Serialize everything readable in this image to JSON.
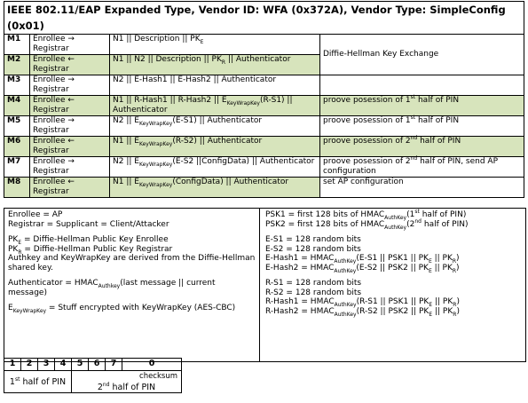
{
  "header": "IEEE 802.11/EAP Expanded Type, Vendor ID: WFA (0x372A), Vendor Type: SimpleConfig (0x01)",
  "messages": [
    {
      "id": "M1",
      "dir": "Enrollee → Registrar",
      "content": "N1 || Description || PK",
      "content_sub": "E",
      "content_rest": "",
      "purpose": ""
    },
    {
      "id": "M2",
      "dir": "Enrollee ← Registrar",
      "content": "N1 || N2 || Description || PK",
      "content_sub": "R",
      "content_rest": " || Authenticator",
      "purpose": ""
    },
    {
      "id": "M3",
      "dir": "Enrollee → Registrar",
      "content": "N2 || E-Hash1 || E-Hash2 || Authenticator",
      "content_sub": "",
      "content_rest": "",
      "purpose": ""
    },
    {
      "id": "M4",
      "dir": "Enrollee ← Registrar",
      "content": "N1 || R-Hash1 || R-Hash2 || E",
      "content_sub": "KeyWrapKey",
      "content_rest": "(R-S1) || Authenticator",
      "purpose": "proove posession of 1",
      "purpose_sup": "st",
      "purpose_rest": " half of PIN"
    },
    {
      "id": "M5",
      "dir": "Enrollee → Registrar",
      "content": "N2 || E",
      "content_sub": "KeyWrapKey",
      "content_rest": "(E-S1) || Authenticator",
      "purpose": "proove posession of 1",
      "purpose_sup": "st",
      "purpose_rest": " half of PIN"
    },
    {
      "id": "M6",
      "dir": "Enrollee ← Registrar",
      "content": "N1 || E",
      "content_sub": "KeyWrapKey",
      "content_rest": "(R-S2) || Authenticator",
      "purpose": "proove posession of 2",
      "purpose_sup": "nd",
      "purpose_rest": " half of PIN"
    },
    {
      "id": "M7",
      "dir": "Enrollee → Registrar",
      "content": "N2 || E",
      "content_sub": "KeyWrapKey",
      "content_rest": "(E-S2 ||ConfigData) || Authenticator",
      "purpose": "proove posession of 2",
      "purpose_sup": "nd",
      "purpose_rest": " half of PIN, send AP configuration"
    },
    {
      "id": "M8",
      "dir": "Enrollee ← Registrar",
      "content": "N1 || E",
      "content_sub": "KeyWrapKey",
      "content_rest": "(ConfigData) || Authenticator",
      "purpose": "set AP configuration",
      "purpose_sup": "",
      "purpose_rest": ""
    }
  ],
  "dh_label": "Diffie-Hellman Key Exchange",
  "legend_left": {
    "l1": "Enrollee = AP",
    "l2": "Registrar = Supplicant = Client/Attacker",
    "l3a": "PK",
    "l3sub": "E",
    "l3b": " = Diffie-Hellman Public Key Enrollee",
    "l4a": "PK",
    "l4sub": "R",
    "l4b": " = Diffie-Hellman Public Key Registrar",
    "l5": "Authkey and KeyWrapKey are derived from the Diffie-Hellman shared key.",
    "l6a": "Authenticator = HMAC",
    "l6sub": "Authkey",
    "l6b": "(last message || current message)",
    "l7a": "E",
    "l7sub": "KeyWrapKey",
    "l7b": " = Stuff encrypted with KeyWrapKey (AES-CBC)"
  },
  "legend_right": {
    "psk1a": "PSK1 = first 128 bits of HMAC",
    "psk1sub": "AuthKey",
    "psk1b": "(1",
    "psk1sup": "st",
    "psk1c": " half of PIN)",
    "psk2a": "PSK2 = first 128 bits of HMAC",
    "psk2sub": "AuthKey",
    "psk2b": "(2",
    "psk2sup": "nd",
    "psk2c": " half of PIN)",
    "es1": "E-S1 = 128 random bits",
    "es2": "E-S2 = 128 random bits",
    "eh1a": "E-Hash1 = HMAC",
    "eh1sub": "AuthKey",
    "eh1b": "(E-S1 || PSK1 || PK",
    "eh1s2": "E",
    "eh1c": " || PK",
    "eh1s3": "R",
    "eh1d": ")",
    "eh2a": "E-Hash2 = HMAC",
    "eh2sub": "AuthKey",
    "eh2b": "(E-S2 || PSK2 || PK",
    "eh2s2": "E",
    "eh2c": " || PK",
    "eh2s3": "R",
    "eh2d": ")",
    "rs1": "R-S1 = 128 random bits",
    "rs2": "R-S2 = 128 random bits",
    "rh1a": "R-Hash1 = HMAC",
    "rh1sub": "AuthKey",
    "rh1b": "(R-S1 || PSK1 || PK",
    "rh1s2": "E",
    "rh1c": " || PK",
    "rh1s3": "R",
    "rh1d": ")",
    "rh2a": "R-Hash2 = HMAC",
    "rh2sub": "AuthKey",
    "rh2b": "(R-S2 || PSK2 || PK",
    "rh2s2": "E",
    "rh2c": " || PK",
    "rh2s3": "R",
    "rh2d": ")"
  },
  "pin": {
    "digits": [
      "1",
      "2",
      "3",
      "4",
      "5",
      "6",
      "7",
      "0"
    ],
    "first_half_a": "1",
    "first_half_sup": "st",
    "first_half_b": " half of PIN",
    "checksum": "checksum",
    "second_half_a": "2",
    "second_half_sup": "nd",
    "second_half_b": " half of PIN"
  }
}
